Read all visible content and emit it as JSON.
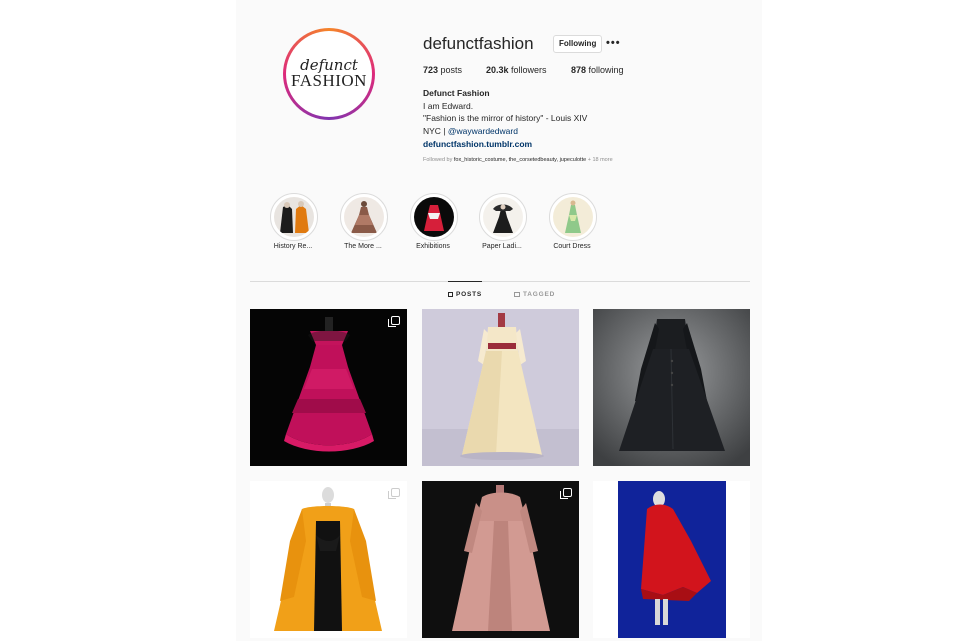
{
  "profile": {
    "username": "defunctfashion",
    "follow_label": "Following",
    "avatar_text_top": "defunct",
    "avatar_text_bottom": "FASHION",
    "posts_count": "723",
    "posts_label": "posts",
    "followers_count": "20.3k",
    "followers_label": "followers",
    "following_count": "878",
    "following_label": "following",
    "display_name": "Defunct Fashion",
    "bio_line1": "I am Edward.",
    "bio_line2": "\"Fashion is the mirror of history\" - Louis XIV",
    "bio_line3_prefix": "NYC | ",
    "bio_mention": "@waywardedward",
    "website": "defunctfashion.tumblr.com",
    "followed_by_prefix": "Followed by ",
    "followed_by_names": "fox_historic_costume, the_corsetedbeauty, jupeculotte",
    "followed_by_suffix": " + 18 more"
  },
  "highlights": [
    {
      "label": "History Re..."
    },
    {
      "label": "The More ..."
    },
    {
      "label": "Exhibitions"
    },
    {
      "label": "Paper Ladi..."
    },
    {
      "label": "Court Dress"
    }
  ],
  "tabs": {
    "posts": "POSTS",
    "tagged": "TAGGED"
  },
  "posts": [
    {
      "name": "pink victorian ball gown",
      "multi": true
    },
    {
      "name": "cream 18th century gown",
      "multi": false
    },
    {
      "name": "black dior coat dress",
      "multi": false
    },
    {
      "name": "yellow opera coat",
      "multi": true
    },
    {
      "name": "rose pink robe",
      "multi": true
    },
    {
      "name": "red fringe cape",
      "multi": false
    }
  ]
}
